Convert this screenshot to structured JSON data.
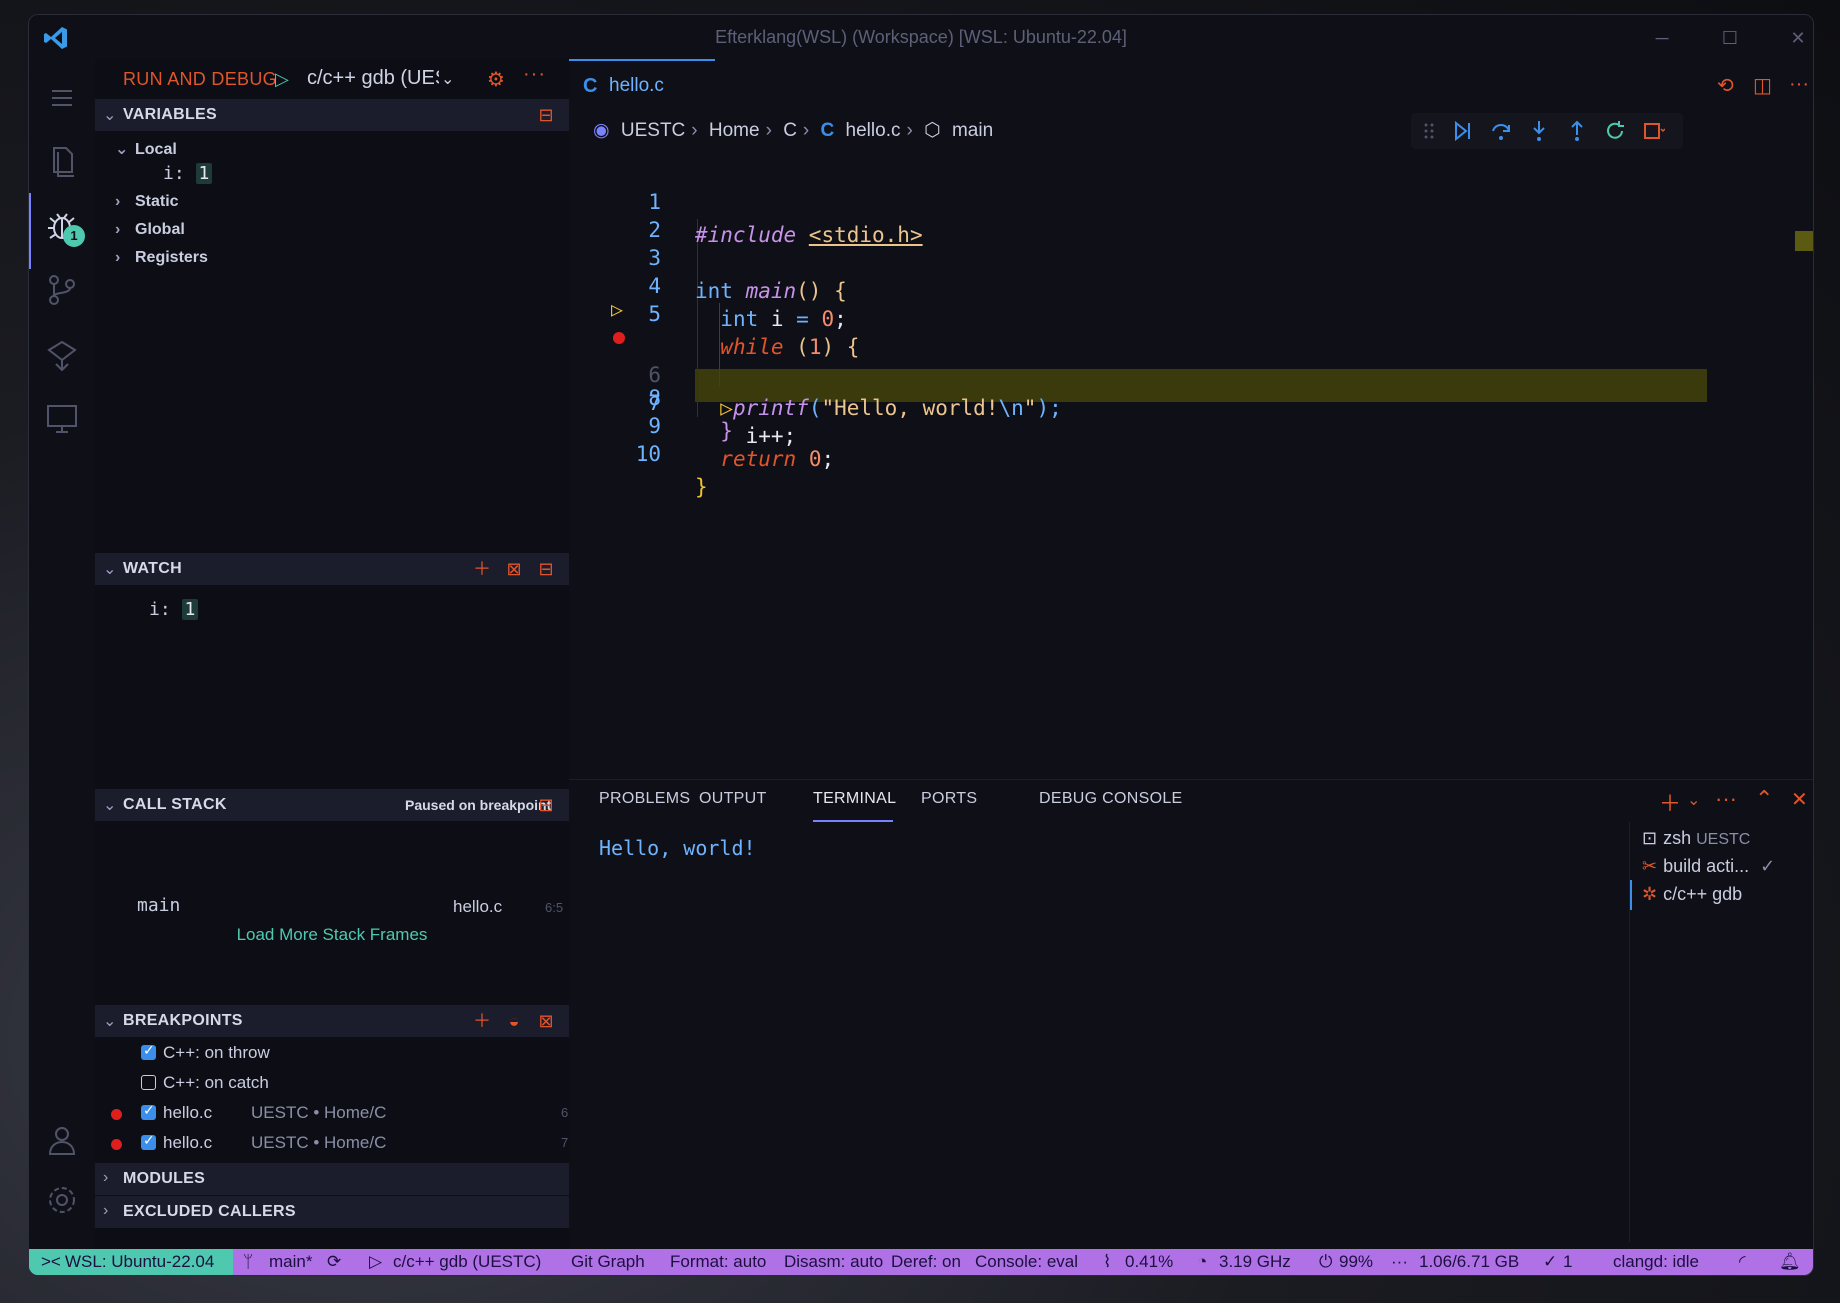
{
  "window": {
    "title": "Efterklang(WSL) (Workspace) [WSL: Ubuntu-22.04]"
  },
  "activity": {
    "debug_badge": "1"
  },
  "sidebar": {
    "title": "RUN AND DEBUG",
    "config": "c/c++ gdb (UESTC)",
    "variables": {
      "title": "VARIABLES",
      "local": "Local",
      "var_name": "i:",
      "var_value": "1",
      "static": "Static",
      "global": "Global",
      "registers": "Registers"
    },
    "watch": {
      "title": "WATCH",
      "name": "i:",
      "value": "1"
    },
    "callstack": {
      "title": "CALL STACK",
      "status": "Paused on breakpoint",
      "frame": "main",
      "file": "hello.c",
      "loc": "6:5",
      "more": "Load More Stack Frames"
    },
    "breakpoints": {
      "title": "BREAKPOINTS",
      "items": [
        {
          "label": "C++: on throw",
          "desc": "",
          "line": "",
          "checked": true
        },
        {
          "label": "C++: on catch",
          "desc": "",
          "line": "",
          "checked": false
        },
        {
          "label": "hello.c",
          "desc": "UESTC • Home/C",
          "line": "6",
          "checked": true
        },
        {
          "label": "hello.c",
          "desc": "UESTC • Home/C",
          "line": "7",
          "checked": true
        }
      ]
    },
    "modules": "MODULES",
    "excluded": "EXCLUDED CALLERS"
  },
  "editor": {
    "tab": "hello.c",
    "tab_icon": "C",
    "breadcrumb": [
      "UESTC",
      "Home",
      "C",
      "hello.c",
      "main"
    ],
    "lines": [
      "1",
      "2",
      "3",
      "4",
      "5",
      "6",
      "7",
      "8",
      "9",
      "10"
    ],
    "code": {
      "l1_a": "#include ",
      "l1_b": "<stdio.h>",
      "l3_a": "int ",
      "l3_b": "main",
      "l3_c": "() {",
      "l4_a": "int ",
      "l4_b": "i ",
      "l4_c": "= ",
      "l4_d": "0",
      "l4_e": ";",
      "l5_a": "while ",
      "l5_b": "(",
      "l5_c": "1",
      "l5_d": ") {",
      "l6_a": "printf",
      "l6_b": "(",
      "l6_c": "\"Hello, world!",
      "l6_d": "\\n",
      "l6_e": "\"",
      "l6_f": ");",
      "l7": "i++;",
      "l8": "}",
      "l9_a": "return ",
      "l9_b": "0",
      "l9_c": ";",
      "l10": "}"
    }
  },
  "panel": {
    "tabs": [
      "PROBLEMS",
      "OUTPUT",
      "TERMINAL",
      "PORTS",
      "DEBUG CONSOLE"
    ],
    "output": "Hello, world!",
    "terminals": [
      {
        "name": "zsh",
        "desc": "UESTC"
      },
      {
        "name": "build acti...",
        "desc": ""
      },
      {
        "name": "c/c++ gdb",
        "desc": ""
      }
    ]
  },
  "status": {
    "remote": "WSL: Ubuntu-22.04",
    "branch": "main*",
    "debug": "c/c++ gdb (UESTC)",
    "gitgraph": "Git Graph",
    "format": "Format: auto",
    "disasm": "Disasm: auto",
    "deref": "Deref: on",
    "console": "Console: eval",
    "cpu": "0.41%",
    "ghz": "3.19 GHz",
    "battery": "99%",
    "mem": "1.06/6.71 GB",
    "checks": "1",
    "clangd": "clangd: idle"
  },
  "colors": {
    "accent": "#e0552a",
    "status": "#b071e6",
    "remote": "#4ec9b0",
    "link": "#3b8eea"
  }
}
